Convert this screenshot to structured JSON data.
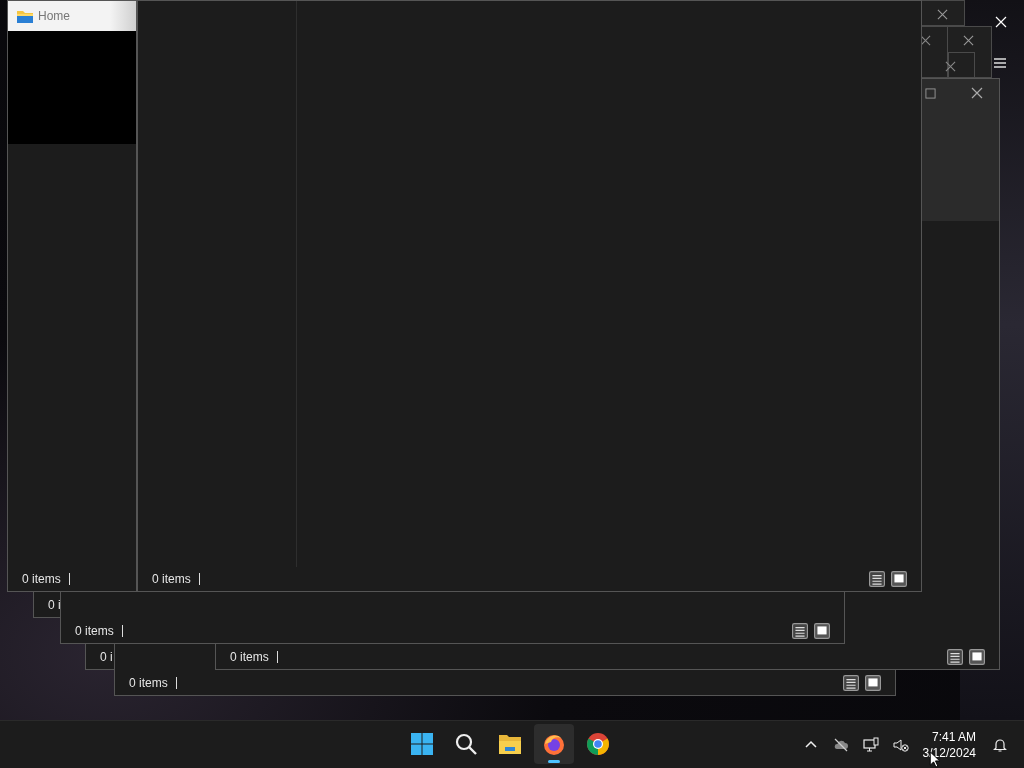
{
  "windows": [
    {
      "status_text": "0 i"
    },
    {
      "status_text": "0 i"
    },
    {
      "status_text": "0 items",
      "view_modes": [
        {
          "selected": false
        },
        {
          "selected": true
        }
      ]
    },
    {
      "status_text": "0 items",
      "view_modes": [
        {
          "selected": false
        },
        {
          "selected": true
        }
      ]
    },
    {
      "status_text": "0 items",
      "view_modes": [
        {
          "selected": false
        },
        {
          "selected": true
        }
      ]
    },
    {
      "status_text": "0 items",
      "view_modes": [
        {
          "selected": false
        },
        {
          "selected": true
        }
      ]
    },
    {
      "title": "Home",
      "status_text": "0 items"
    }
  ],
  "taskbar": {
    "apps": [
      {
        "kind": "start",
        "selected": false
      },
      {
        "kind": "search",
        "selected": false
      },
      {
        "kind": "folder",
        "selected": false
      },
      {
        "kind": "fox",
        "selected": true
      },
      {
        "kind": "chrome",
        "selected": false
      }
    ],
    "clock": {
      "time": "7:41 AM",
      "date": "3/12/2024"
    }
  }
}
